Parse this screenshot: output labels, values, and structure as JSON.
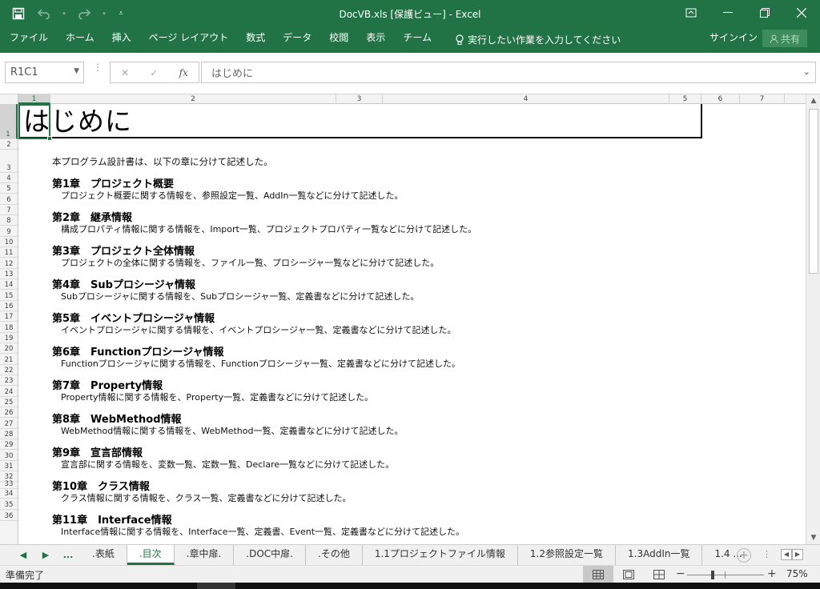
{
  "window": {
    "title": "DocVB.xls  [保護ビュー] - Excel",
    "undo_icon": "undo-icon",
    "redo_icon": "redo-icon",
    "save_icon": "save-icon"
  },
  "ribbon": {
    "tabs": [
      "ファイル",
      "ホーム",
      "挿入",
      "ページ レイアウト",
      "数式",
      "データ",
      "校閲",
      "表示",
      "チーム"
    ],
    "tellme": "実行したい作業を入力してください",
    "signin": "サインイン",
    "share": "共有"
  },
  "formula_bar": {
    "name_box": "R1C1",
    "fx": "fx",
    "value": "はじめに"
  },
  "columns": [
    "1",
    "2",
    "3",
    "4",
    "5",
    "6",
    "7"
  ],
  "rows": [
    "1",
    "2",
    "3",
    "4",
    "5",
    "6",
    "7",
    "8",
    "9",
    "10",
    "11",
    "12",
    "13",
    "14",
    "15",
    "16",
    "17",
    "18",
    "19",
    "20",
    "21",
    "22",
    "23",
    "24",
    "25",
    "26",
    "27",
    "28",
    "29",
    "30",
    "31",
    "32",
    "33",
    "34",
    "35",
    "36"
  ],
  "sheet": {
    "title": "はじめに",
    "intro": "本プログラム設計書は、以下の章に分けて記述した。",
    "chapters": [
      {
        "heading": "第1章　プロジェクト概要",
        "desc": "プロジェクト概要に関する情報を、参照設定一覧、AddIn一覧などに分けて記述した。"
      },
      {
        "heading": "第2章　継承情報",
        "desc": "構成プロパティ情報に関する情報を、Import一覧、プロジェクトプロパティ一覧などに分けて記述した。"
      },
      {
        "heading": "第3章　プロジェクト全体情報",
        "desc": "プロジェクトの全体に関する情報を、ファイル一覧、プロシージャ一覧などに分けて記述した。"
      },
      {
        "heading": "第4章　Subプロシージャ情報",
        "desc": "Subプロシージャに関する情報を、Subプロシージャ一覧、定義書などに分けて記述した。"
      },
      {
        "heading": "第5章　イベントプロシージャ情報",
        "desc": "イベントプロシージャに関する情報を、イベントプロシージャ一覧、定義書などに分けて記述した。"
      },
      {
        "heading": "第6章　Functionプロシージャ情報",
        "desc": "Functionプロシージャに関する情報を、Functionプロシージャ一覧、定義書などに分けて記述した。"
      },
      {
        "heading": "第7章　Property情報",
        "desc": "Property情報に関する情報を、Property一覧、定義書などに分けて記述した。"
      },
      {
        "heading": "第8章　WebMethod情報",
        "desc": "WebMethod情報に関する情報を、WebMethod一覧、定義書などに分けて記述した。"
      },
      {
        "heading": "第9章　宣言部情報",
        "desc": "宣言部に関する情報を、変数一覧、定数一覧、Declare一覧などに分けて記述した。"
      },
      {
        "heading": "第10章　クラス情報",
        "desc": "クラス情報に関する情報を、クラス一覧、定義書などに分けて記述した。"
      },
      {
        "heading": "第11章　Interface情報",
        "desc": "Interface情報に関する情報を、Interface一覧、定義書、Event一覧、定義書などに分けて記述した。"
      }
    ]
  },
  "sheet_tabs": {
    "more_left": "...",
    "tabs": [
      ".表紙",
      ".目次",
      ".章中扉.",
      ".DOC中扉.",
      ".その他",
      "1.1プロジェクトファイル情報",
      "1.2参照設定一覧",
      "1.3AddIn一覧",
      "1.4 ..."
    ],
    "active_index": 1
  },
  "status": {
    "text": "準備完了",
    "zoom": "75%",
    "zoom_level": 0.75
  }
}
